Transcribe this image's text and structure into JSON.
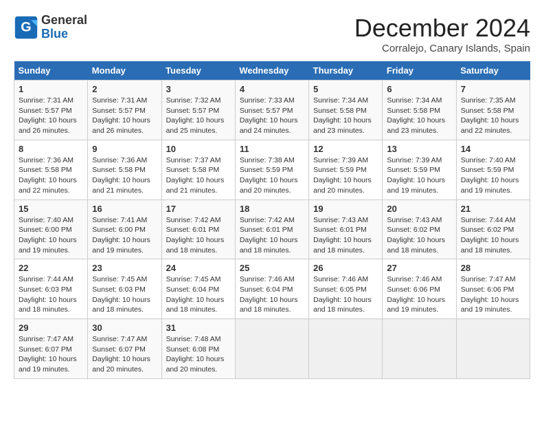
{
  "logo": {
    "text_general": "General",
    "text_blue": "Blue"
  },
  "title": "December 2024",
  "subtitle": "Corralejo, Canary Islands, Spain",
  "days_of_week": [
    "Sunday",
    "Monday",
    "Tuesday",
    "Wednesday",
    "Thursday",
    "Friday",
    "Saturday"
  ],
  "weeks": [
    [
      {
        "day": "1",
        "info": "Sunrise: 7:31 AM\nSunset: 5:57 PM\nDaylight: 10 hours\nand 26 minutes."
      },
      {
        "day": "2",
        "info": "Sunrise: 7:31 AM\nSunset: 5:57 PM\nDaylight: 10 hours\nand 26 minutes."
      },
      {
        "day": "3",
        "info": "Sunrise: 7:32 AM\nSunset: 5:57 PM\nDaylight: 10 hours\nand 25 minutes."
      },
      {
        "day": "4",
        "info": "Sunrise: 7:33 AM\nSunset: 5:57 PM\nDaylight: 10 hours\nand 24 minutes."
      },
      {
        "day": "5",
        "info": "Sunrise: 7:34 AM\nSunset: 5:58 PM\nDaylight: 10 hours\nand 23 minutes."
      },
      {
        "day": "6",
        "info": "Sunrise: 7:34 AM\nSunset: 5:58 PM\nDaylight: 10 hours\nand 23 minutes."
      },
      {
        "day": "7",
        "info": "Sunrise: 7:35 AM\nSunset: 5:58 PM\nDaylight: 10 hours\nand 22 minutes."
      }
    ],
    [
      {
        "day": "8",
        "info": "Sunrise: 7:36 AM\nSunset: 5:58 PM\nDaylight: 10 hours\nand 22 minutes."
      },
      {
        "day": "9",
        "info": "Sunrise: 7:36 AM\nSunset: 5:58 PM\nDaylight: 10 hours\nand 21 minutes."
      },
      {
        "day": "10",
        "info": "Sunrise: 7:37 AM\nSunset: 5:58 PM\nDaylight: 10 hours\nand 21 minutes."
      },
      {
        "day": "11",
        "info": "Sunrise: 7:38 AM\nSunset: 5:59 PM\nDaylight: 10 hours\nand 20 minutes."
      },
      {
        "day": "12",
        "info": "Sunrise: 7:39 AM\nSunset: 5:59 PM\nDaylight: 10 hours\nand 20 minutes."
      },
      {
        "day": "13",
        "info": "Sunrise: 7:39 AM\nSunset: 5:59 PM\nDaylight: 10 hours\nand 19 minutes."
      },
      {
        "day": "14",
        "info": "Sunrise: 7:40 AM\nSunset: 5:59 PM\nDaylight: 10 hours\nand 19 minutes."
      }
    ],
    [
      {
        "day": "15",
        "info": "Sunrise: 7:40 AM\nSunset: 6:00 PM\nDaylight: 10 hours\nand 19 minutes."
      },
      {
        "day": "16",
        "info": "Sunrise: 7:41 AM\nSunset: 6:00 PM\nDaylight: 10 hours\nand 19 minutes."
      },
      {
        "day": "17",
        "info": "Sunrise: 7:42 AM\nSunset: 6:01 PM\nDaylight: 10 hours\nand 18 minutes."
      },
      {
        "day": "18",
        "info": "Sunrise: 7:42 AM\nSunset: 6:01 PM\nDaylight: 10 hours\nand 18 minutes."
      },
      {
        "day": "19",
        "info": "Sunrise: 7:43 AM\nSunset: 6:01 PM\nDaylight: 10 hours\nand 18 minutes."
      },
      {
        "day": "20",
        "info": "Sunrise: 7:43 AM\nSunset: 6:02 PM\nDaylight: 10 hours\nand 18 minutes."
      },
      {
        "day": "21",
        "info": "Sunrise: 7:44 AM\nSunset: 6:02 PM\nDaylight: 10 hours\nand 18 minutes."
      }
    ],
    [
      {
        "day": "22",
        "info": "Sunrise: 7:44 AM\nSunset: 6:03 PM\nDaylight: 10 hours\nand 18 minutes."
      },
      {
        "day": "23",
        "info": "Sunrise: 7:45 AM\nSunset: 6:03 PM\nDaylight: 10 hours\nand 18 minutes."
      },
      {
        "day": "24",
        "info": "Sunrise: 7:45 AM\nSunset: 6:04 PM\nDaylight: 10 hours\nand 18 minutes."
      },
      {
        "day": "25",
        "info": "Sunrise: 7:46 AM\nSunset: 6:04 PM\nDaylight: 10 hours\nand 18 minutes."
      },
      {
        "day": "26",
        "info": "Sunrise: 7:46 AM\nSunset: 6:05 PM\nDaylight: 10 hours\nand 18 minutes."
      },
      {
        "day": "27",
        "info": "Sunrise: 7:46 AM\nSunset: 6:06 PM\nDaylight: 10 hours\nand 19 minutes."
      },
      {
        "day": "28",
        "info": "Sunrise: 7:47 AM\nSunset: 6:06 PM\nDaylight: 10 hours\nand 19 minutes."
      }
    ],
    [
      {
        "day": "29",
        "info": "Sunrise: 7:47 AM\nSunset: 6:07 PM\nDaylight: 10 hours\nand 19 minutes."
      },
      {
        "day": "30",
        "info": "Sunrise: 7:47 AM\nSunset: 6:07 PM\nDaylight: 10 hours\nand 20 minutes."
      },
      {
        "day": "31",
        "info": "Sunrise: 7:48 AM\nSunset: 6:08 PM\nDaylight: 10 hours\nand 20 minutes."
      },
      {
        "day": "",
        "info": ""
      },
      {
        "day": "",
        "info": ""
      },
      {
        "day": "",
        "info": ""
      },
      {
        "day": "",
        "info": ""
      }
    ]
  ]
}
